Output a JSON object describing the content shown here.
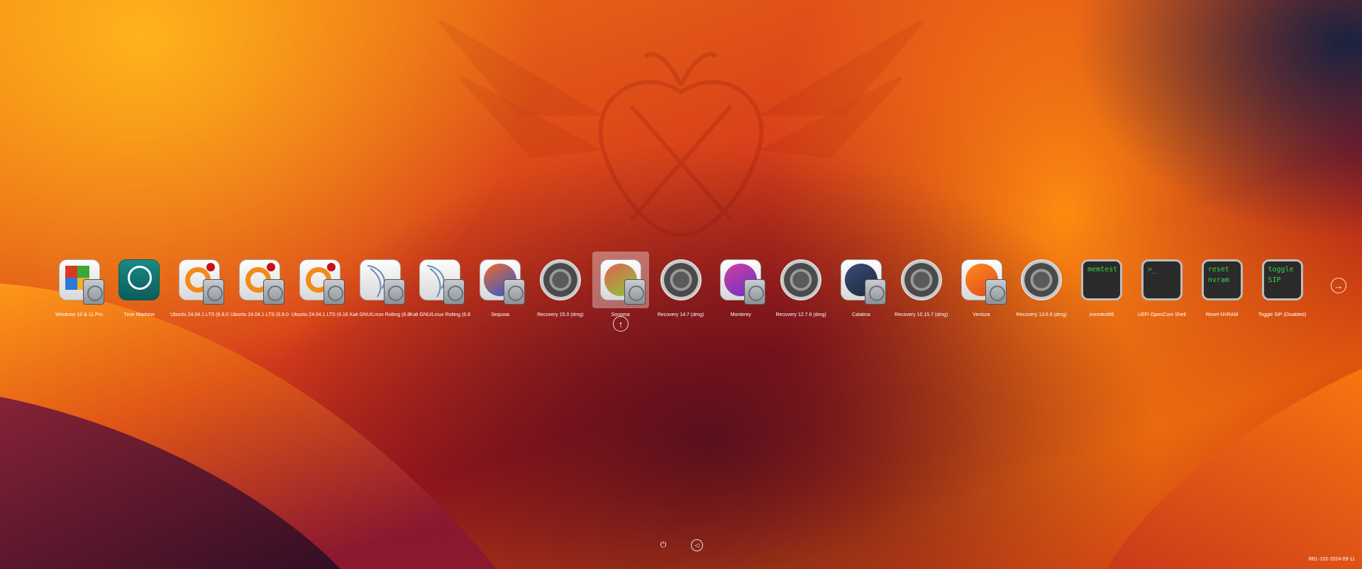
{
  "entries": [
    {
      "label": "Windows 10 & 11 Pro",
      "type": "windows"
    },
    {
      "label": "Time Machine",
      "type": "timemachine"
    },
    {
      "label": "Ubuntu 24.04.1 LTS (6.8.0",
      "type": "ubuntu"
    },
    {
      "label": "Ubuntu 24.04.1 LTS (6.8.0",
      "type": "ubuntu"
    },
    {
      "label": "Ubuntu 24.04.1 LTS (6.16",
      "type": "ubuntu"
    },
    {
      "label": "Kali GNU/Linux Rolling (6.8",
      "type": "kali"
    },
    {
      "label": "Kali GNU/Linux Rolling (6.8",
      "type": "kali"
    },
    {
      "label": "Sequoia",
      "type": "macos",
      "color1": "#f06a28",
      "color2": "#2a5ad8"
    },
    {
      "label": "Recovery 15.0 (dmg)",
      "type": "recovery"
    },
    {
      "label": "Sonoma",
      "type": "macos",
      "color1": "#e06050",
      "color2": "#8cc83a"
    },
    {
      "label": "Recovery 14.7 (dmg)",
      "type": "recovery"
    },
    {
      "label": "Monterey",
      "type": "macos",
      "color1": "#d040a0",
      "color2": "#6a30c8"
    },
    {
      "label": "Recovery 12.7.6 (dmg)",
      "type": "recovery"
    },
    {
      "label": "Catalina",
      "type": "macos",
      "color1": "#3a4a7a",
      "color2": "#1e2a3a"
    },
    {
      "label": "Recovery 10.15.7 (dmg)",
      "type": "recovery"
    },
    {
      "label": "Ventura",
      "type": "macos",
      "color1": "#ff8a20",
      "color2": "#e04a18"
    },
    {
      "label": "Recovery 13.6.9 (dmg)",
      "type": "recovery"
    },
    {
      "label": "memtest86",
      "type": "tool",
      "text": "memtest"
    },
    {
      "label": "UEFI OpenCore Shell",
      "type": "tool",
      "text": ">_"
    },
    {
      "label": "Reset NVRAM",
      "type": "tool",
      "text": "reset\nnvram"
    },
    {
      "label": "Toggle SIP (Disabled)",
      "type": "tool",
      "text": "toggle\nSIP"
    }
  ],
  "selected_index": 9,
  "version": "REL-102-2024-09-11",
  "colors": {
    "selection": "#ffffff59",
    "terminal_text": "#3ad24a"
  }
}
